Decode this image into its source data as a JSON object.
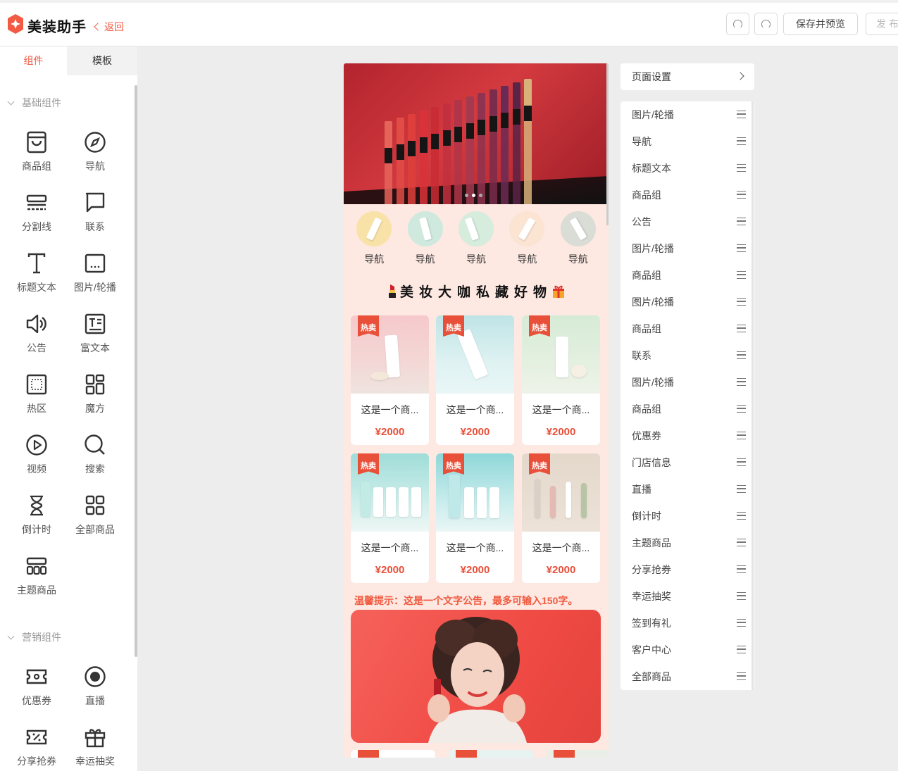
{
  "header": {
    "app_title": "美装助手",
    "back_label": "返回",
    "save_preview_label": "保存并预览",
    "publish_label": "发 布"
  },
  "left_panel": {
    "tabs": [
      "组件",
      "模板"
    ],
    "basic_section": "基础组件",
    "basic_components": [
      {
        "label": "商品组",
        "icon": "bag-icon"
      },
      {
        "label": "导航",
        "icon": "compass-icon"
      },
      {
        "label": "分割线",
        "icon": "divider-icon"
      },
      {
        "label": "联系",
        "icon": "chat-icon"
      },
      {
        "label": "标题文本",
        "icon": "text-t-icon"
      },
      {
        "label": "图片/轮播",
        "icon": "image-icon"
      },
      {
        "label": "公告",
        "icon": "speaker-icon"
      },
      {
        "label": "富文本",
        "icon": "richtext-icon"
      },
      {
        "label": "热区",
        "icon": "hotzone-icon"
      },
      {
        "label": "魔方",
        "icon": "cube-icon"
      },
      {
        "label": "视频",
        "icon": "video-icon"
      },
      {
        "label": "搜索",
        "icon": "search-icon"
      },
      {
        "label": "倒计时",
        "icon": "hourglass-icon"
      },
      {
        "label": "全部商品",
        "icon": "grid-icon"
      },
      {
        "label": "主题商品",
        "icon": "theme-goods-icon"
      }
    ],
    "marketing_section": "营销组件",
    "marketing_components": [
      {
        "label": "优惠券",
        "icon": "coupon-icon"
      },
      {
        "label": "直播",
        "icon": "live-icon"
      },
      {
        "label": "分享抢券",
        "icon": "share-coupon-icon"
      },
      {
        "label": "幸运抽奖",
        "icon": "gift-icon"
      }
    ]
  },
  "preview": {
    "nav_items": [
      "导航",
      "导航",
      "导航",
      "导航",
      "导航"
    ],
    "section_title": "美妆大咖私藏好物",
    "hot_badge": "热卖",
    "products": [
      {
        "name": "这是一个商...",
        "price": "¥2000"
      },
      {
        "name": "这是一个商...",
        "price": "¥2000"
      },
      {
        "name": "这是一个商...",
        "price": "¥2000"
      },
      {
        "name": "这是一个商...",
        "price": "¥2000"
      },
      {
        "name": "这是一个商...",
        "price": "¥2000"
      },
      {
        "name": "这是一个商...",
        "price": "¥2000"
      }
    ],
    "notice": "温馨提示：这是一个文字公告，最多可输入150字。"
  },
  "right_panel": {
    "page_settings": "页面设置",
    "layers": [
      "图片/轮播",
      "导航",
      "标题文本",
      "商品组",
      "公告",
      "图片/轮播",
      "商品组",
      "图片/轮播",
      "商品组",
      "联系",
      "图片/轮播",
      "商品组",
      "优惠券",
      "门店信息",
      "直播",
      "倒计时",
      "主题商品",
      "分享抢券",
      "幸运抽奖",
      "签到有礼",
      "客户中心",
      "全部商品"
    ]
  },
  "colors": {
    "accent": "#f25a43",
    "price": "#e8503a",
    "preview_bg": "#fde8e2"
  }
}
